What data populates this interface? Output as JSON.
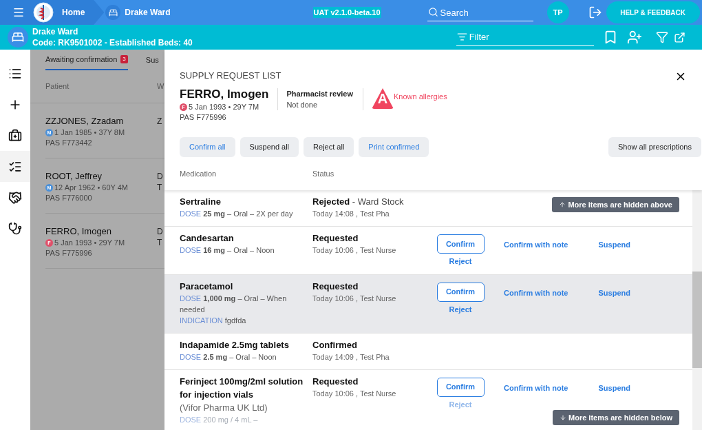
{
  "topbar": {
    "home": "Home",
    "ward": "Drake Ward",
    "version": "UAT v2.1.0-beta.10",
    "search_placeholder": "Search",
    "avatar": "TP",
    "help": "HELP & FEEDBACK"
  },
  "wardbar": {
    "name": "Drake Ward",
    "code": "Code: RK9501002 - Established Beds: 40",
    "filter_placeholder": "Filter"
  },
  "rail": [
    {
      "selected": false
    },
    {
      "selected": false
    },
    {
      "selected": false
    },
    {
      "selected": true
    },
    {
      "selected": false
    },
    {
      "selected": false
    }
  ],
  "background_list": {
    "tabs": [
      {
        "label": "Awaiting confirmation",
        "badge": "3",
        "selected": true
      },
      {
        "label": "Sus",
        "selected": false
      }
    ],
    "columns": [
      "Patient",
      "W"
    ],
    "rows": [
      {
        "name": "ZZJONES, Zzadam",
        "sex": "M",
        "dob": "1 Jan 1985 • 37Y 8M",
        "pas": "PAS F773442",
        "column_2": [
          "Z"
        ]
      },
      {
        "name": "ROOT, Jeffrey",
        "sex": "M",
        "dob": "12 Apr 1962 • 60Y 4M",
        "pas": "PAS F776000",
        "column_2": [
          "D",
          "T"
        ]
      },
      {
        "name": "FERRO, Imogen",
        "sex": "F",
        "dob": "5 Jan 1993 • 29Y 7M",
        "pas": "PAS F775996",
        "column_2": [
          "D",
          "T"
        ]
      }
    ]
  },
  "panel": {
    "title": "SUPPLY REQUEST LIST",
    "patient": {
      "name": "FERRO, Imogen",
      "sex": "F",
      "dob": "5 Jan 1993 • 29Y 7M",
      "pas": "PAS F775996"
    },
    "review_label": "Pharmacist review",
    "review_value": "Not done",
    "allergy_icon": "A",
    "allergies": "Known allergies",
    "actions": [
      {
        "label": "Confirm all",
        "kind": "primary"
      },
      {
        "label": "Suspend all",
        "kind": "plain"
      },
      {
        "label": "Reject all",
        "kind": "plain"
      },
      {
        "label": "Print confirmed",
        "kind": "primary"
      }
    ],
    "show_all": "Show all prescriptions",
    "columns": [
      "Medication",
      "Status"
    ],
    "hidden_above": "More items are hidden above",
    "hidden_below": "More items are hidden below",
    "items": [
      {
        "name": "Sertraline",
        "dose_label": "DOSE",
        "dose": "**25 mg** – Oral – 2X per day",
        "status": "Rejected",
        "status_note": "- Ward Stock",
        "when": "Today 14:08 , Test Pha",
        "selected": false,
        "faded": false
      },
      {
        "name": "Candesartan",
        "dose_label": "DOSE",
        "dose": "**16 mg** – Oral – Noon",
        "status": "Requested",
        "when": "Today 10:06 , Test Nurse",
        "actions": {
          "confirm": "Confirm",
          "reject": "Reject",
          "note": "Confirm with note",
          "suspend": "Suspend"
        },
        "selected": false,
        "faded": false
      },
      {
        "name": "Paracetamol",
        "dose_label": "DOSE",
        "dose": "**1,000 mg** – Oral – When needed",
        "indication_label": "INDICATION",
        "indication": "fgdfda",
        "status": "Requested",
        "when": "Today 10:06 , Test Nurse",
        "actions": {
          "confirm": "Confirm",
          "reject": "Reject",
          "note": "Confirm with note",
          "suspend": "Suspend"
        },
        "selected": true,
        "faded": false
      },
      {
        "name": "Indapamide 2.5mg tablets",
        "dose_label": "DOSE",
        "dose": "**2.5 mg** – Oral – Noon",
        "status": "Confirmed",
        "when": "Today 14:09 , Test Pha",
        "selected": false,
        "faded": false
      },
      {
        "name": "Ferinject 100mg/2ml solution for injection vials",
        "subtitle": "(Vifor Pharma UK Ltd)",
        "dose_label": "DOSE",
        "dose": "200 mg / 4 mL –",
        "status": "Requested",
        "when": "Today 10:06 , Test Nurse",
        "actions": {
          "confirm": "Confirm",
          "reject": "Reject",
          "note": "Confirm with note",
          "suspend": "Suspend"
        },
        "selected": false,
        "faded": true
      }
    ]
  }
}
